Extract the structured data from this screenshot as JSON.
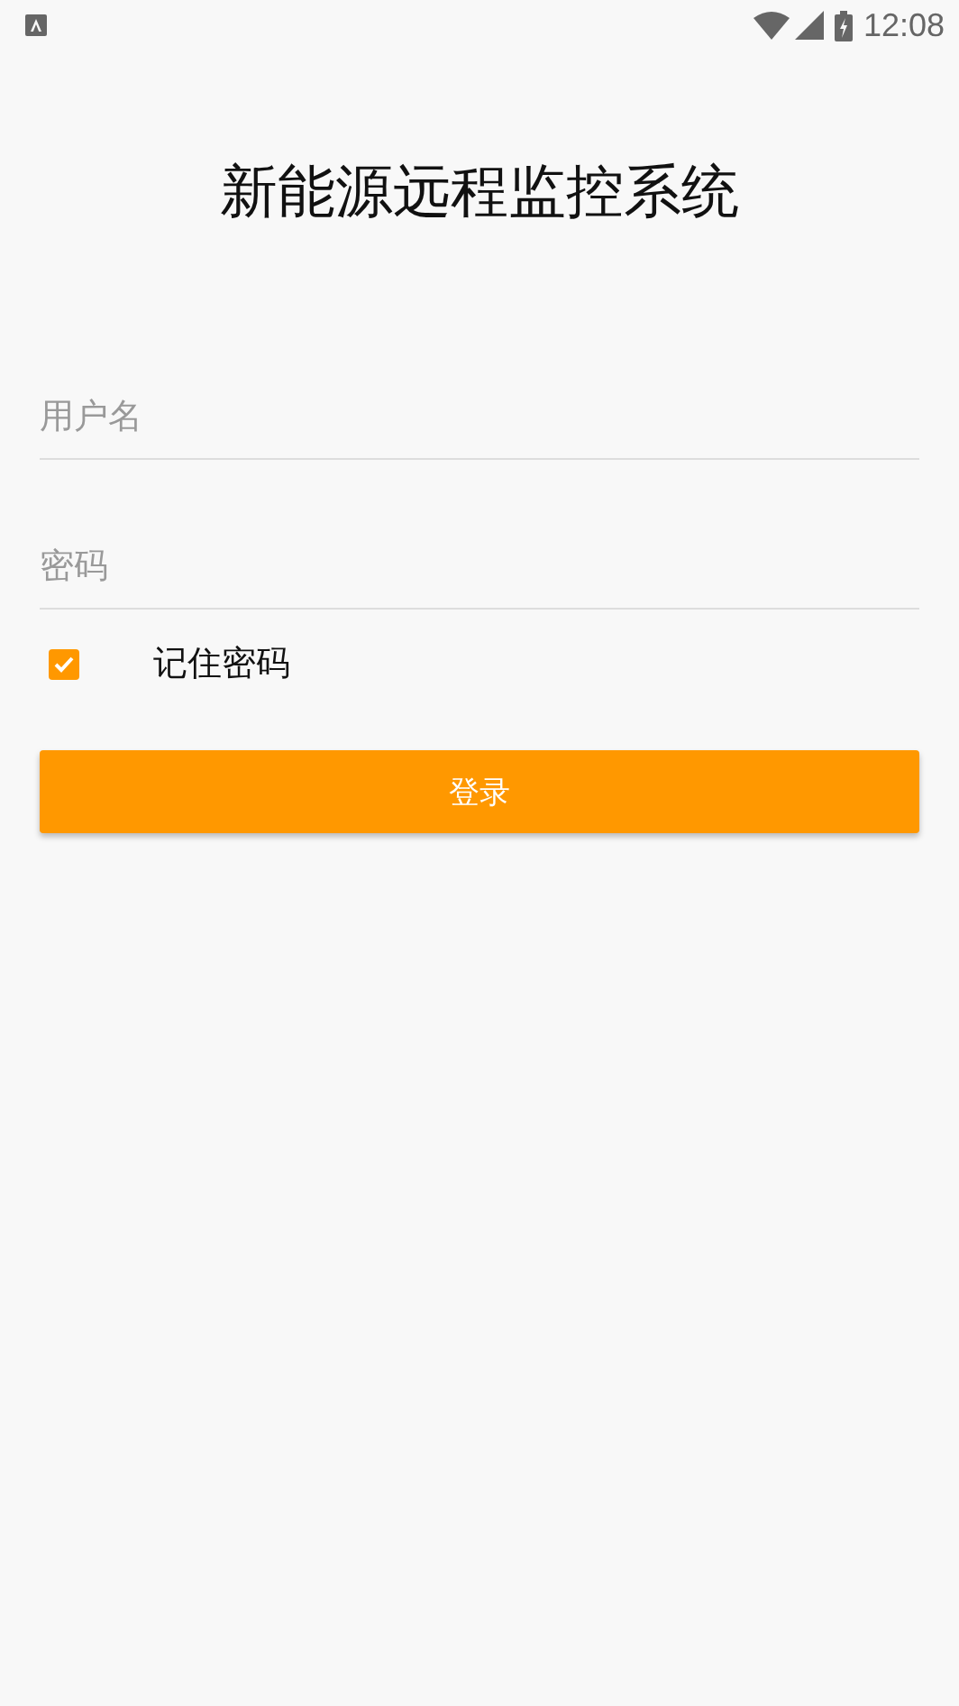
{
  "status_bar": {
    "time": "12:08"
  },
  "title": "新能源远程监控系统",
  "fields": [
    {
      "placeholder": "用户名"
    },
    {
      "placeholder": "密码"
    }
  ],
  "remember": {
    "label": "记住密码",
    "checked": true
  },
  "login_button": "登录"
}
